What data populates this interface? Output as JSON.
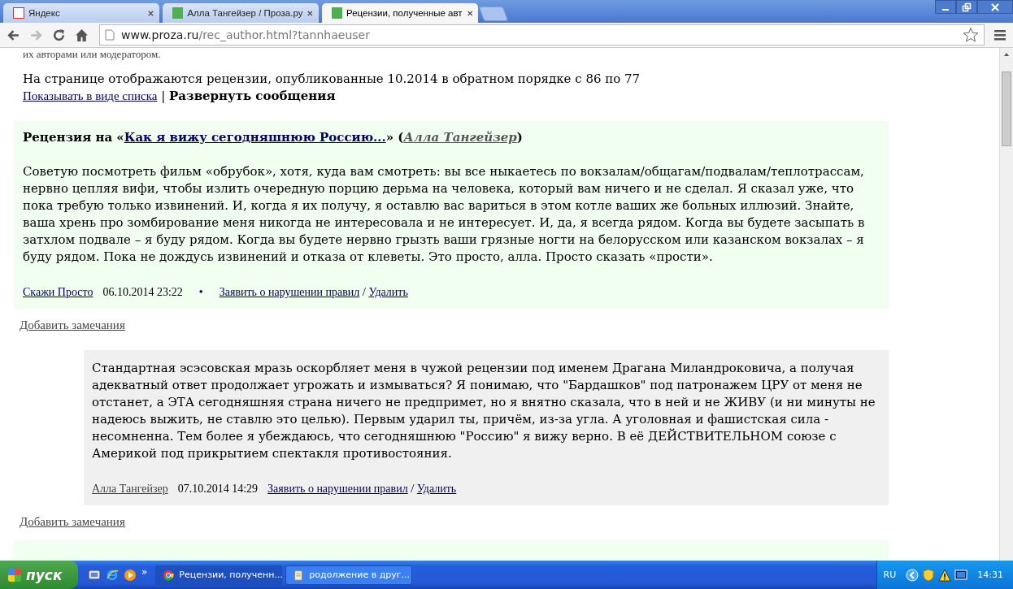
{
  "tabs": [
    {
      "label": "Яндекс",
      "selected": false
    },
    {
      "label": "Алла Тангейзер / Проза.ру",
      "selected": false
    },
    {
      "label": "Рецензии, полученные авт",
      "selected": true
    }
  ],
  "address": {
    "host": "www.proza.ru",
    "path": "/rec_author.html?tannhaeuser"
  },
  "intro": {
    "cut_line": "их авторами или модератором.",
    "info": "На странице отображаются рецензии, опубликованные 10.2014 в обратном порядке с 86 по 77",
    "list_link": "Показывать в виде списка",
    "separator": "|",
    "expand": "Развернуть сообщения"
  },
  "entries": [
    {
      "kind": "review",
      "heading": {
        "prefix": "Рецензия на «",
        "work": "Как я вижу сегодняшнюю Россию...",
        "middle": "» (",
        "author": "Алла Тангейзер",
        "suffix": ")"
      },
      "text": "Советую посмотреть фильм «обрубок», хотя, куда вам смотреть: вы все ныкаетесь по вокзалам/общагам/подвалам/теплотрассам, нервно цепляя вифи, чтобы излить очередную порцию дерьма на человека, который вам ничего и не сделал. Я сказал уже, что пока требую только извинений. И, когда я их получу, я оставлю вас вариться в этом котле ваших же больных иллюзий. Знайте, ваша хрень про зомбирование меня никогда не интересовала и не интересует. И, да, я всегда рядом. Когда вы будете засыпать в затхлом подвале – я буду рядом. Когда вы будете нервно грызть ваши грязные ногти на белорусском или казанском вокзалах – я буду рядом. Пока не дождусь извинений и отказа от клеветы. Это просто, алла. Просто сказать «прости».",
      "footer": {
        "author": "Скажи Просто",
        "date": "06.10.2014 23:22",
        "bullet": "•",
        "report": "Заявить о нарушении правил",
        "slash": "/",
        "delete": "Удалить"
      },
      "add_note": "Добавить замечания"
    },
    {
      "kind": "reply",
      "text": "Стандартная эсэсовская мразь оскорбляет меня в чужой рецензии под именем Драгана Миландроковича, а получая адекватный ответ продолжает угрожать и измываться? Я понимаю, что \"Бардашков\" под патронажем ЦРУ от меня не отстанет, а ЭТА сегодняшняя страна ничего не предпримет, но я внятно сказала, что в ней и не ЖИВУ (и ни минуты не надеюсь выжить, не ставлю это целью). Первым ударил ты, причём, из-за угла. А уголовная и фашистская сила - несомненна. Тем более я убеждаюсь, что сегодняшнюю \"Россию\" я вижу верно. В её ДЕЙСТВИТЕЛЬНОМ союзе с Америкой под прикрытием спектакля противостояния.",
      "footer": {
        "author": "Алла Тангейзер",
        "date": "07.10.2014 14:29",
        "report": "Заявить о нарушении правил",
        "slash": "/",
        "delete": "Удалить"
      },
      "add_note": "Добавить замечания"
    }
  ],
  "taskbar": {
    "start": "пуск",
    "more": "»",
    "tasks": [
      {
        "label": "Рецензии, полученн...",
        "selected": true
      },
      {
        "label": "родолжение в друг...",
        "selected": false
      }
    ],
    "lang": "RU",
    "time": "14:31"
  }
}
